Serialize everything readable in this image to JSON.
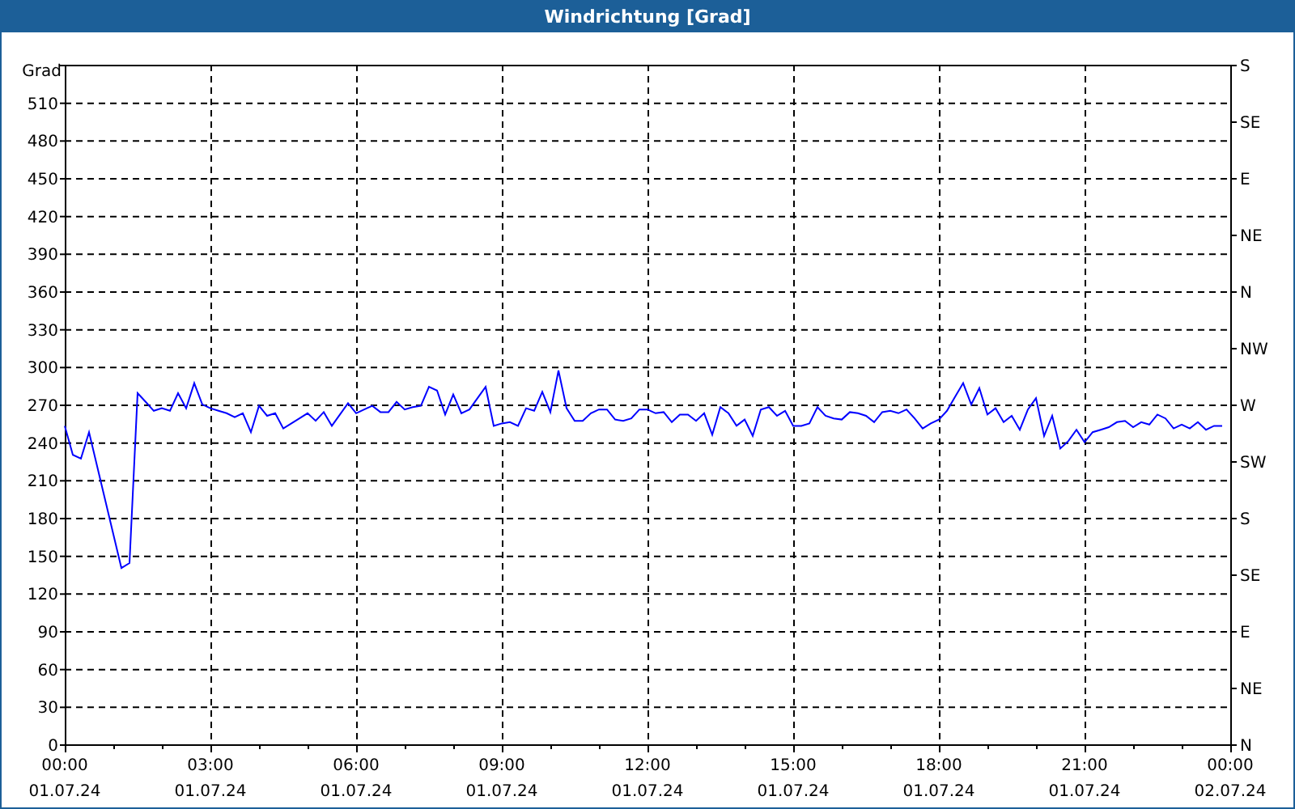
{
  "window": {
    "title": "Windrichtung [Grad]"
  },
  "chart": {
    "chart_data": {
      "type": "line",
      "ylabel": "Grad",
      "categories": [
        "00:00\n01.07.24",
        null,
        null,
        null,
        null,
        null,
        null,
        null,
        null,
        null,
        null,
        null,
        null,
        null,
        null,
        null,
        null,
        null,
        "03:00\n01.07.24",
        null,
        null,
        null,
        null,
        null,
        null,
        null,
        null,
        null,
        null,
        null,
        null,
        null,
        null,
        null,
        null,
        null,
        "06:00\n01.07.24",
        null,
        null,
        null,
        null,
        null,
        null,
        null,
        null,
        null,
        null,
        null,
        null,
        null,
        null,
        null,
        null,
        null,
        "09:00\n01.07.24",
        null,
        null,
        null,
        null,
        null,
        null,
        null,
        null,
        null,
        null,
        null,
        null,
        null,
        null,
        null,
        null,
        null,
        "12:00\n01.07.24",
        null,
        null,
        null,
        null,
        null,
        null,
        null,
        null,
        null,
        null,
        null,
        null,
        null,
        null,
        null,
        null,
        null,
        "15:00\n01.07.24",
        null,
        null,
        null,
        null,
        null,
        null,
        null,
        null,
        null,
        null,
        null,
        null,
        null,
        null,
        null,
        null,
        null,
        "18:00\n01.07.24",
        null,
        null,
        null,
        null,
        null,
        null,
        null,
        null,
        null,
        null,
        null,
        null,
        null,
        null,
        null,
        null,
        null,
        "21:00\n01.07.24",
        null,
        null,
        null,
        null,
        null,
        null,
        null,
        null,
        null,
        null,
        null,
        null,
        null,
        null,
        null,
        null,
        null,
        "00:00\n02.07.24"
      ],
      "series": [
        {
          "color": "#0000ff",
          "values": [
            253,
            230,
            227,
            248,
            221,
            194,
            167,
            140,
            144,
            279,
            272,
            265,
            267,
            265,
            279,
            267,
            287,
            270,
            267,
            265,
            263,
            260,
            263,
            248,
            269,
            261,
            263,
            251,
            255,
            259,
            263,
            257,
            264,
            253,
            262,
            271,
            263,
            266,
            269,
            264,
            264,
            272,
            266,
            268,
            269,
            284,
            281,
            262,
            278,
            263,
            266,
            275,
            284,
            253,
            255,
            256,
            253,
            267,
            265,
            280,
            264,
            297,
            267,
            257,
            257,
            263,
            266,
            266,
            258,
            257,
            259,
            266,
            266,
            263,
            264,
            256,
            262,
            262,
            257,
            263,
            246,
            268,
            263,
            253,
            258,
            245,
            266,
            268,
            261,
            265,
            253,
            253,
            255,
            268,
            261,
            259,
            258,
            264,
            263,
            261,
            256,
            264,
            265,
            263,
            266,
            259,
            251,
            255,
            258,
            265,
            276,
            287,
            270,
            283,
            262,
            267,
            256,
            261,
            250,
            266,
            275,
            245,
            261,
            235,
            241,
            250,
            240,
            248,
            250,
            252,
            256,
            257,
            252,
            256,
            254,
            262,
            259,
            251,
            254,
            251,
            256,
            250,
            253,
            253,
            null
          ]
        }
      ],
      "ylim": [
        0,
        540
      ],
      "grid": true,
      "yticks": [
        0,
        30,
        60,
        90,
        120,
        150,
        180,
        210,
        240,
        270,
        300,
        330,
        360,
        390,
        420,
        450,
        480,
        510
      ]
    },
    "compass_labels": [
      "S",
      "SE",
      "E",
      "NE",
      "N",
      "NW",
      "W",
      "SW",
      "S",
      "SE",
      "E",
      "NE",
      "N"
    ]
  }
}
